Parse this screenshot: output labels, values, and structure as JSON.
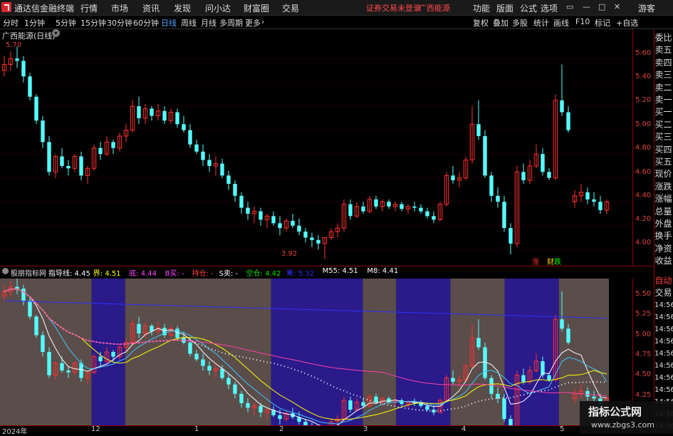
{
  "app": {
    "title": "通达信金融终端",
    "warning": "证券交易未登录",
    "stock_link": "广西能源",
    "guest": "游客"
  },
  "menu": [
    "行情",
    "市场",
    "资讯",
    "发现",
    "问小达",
    "财富圈",
    "交易"
  ],
  "right_menu": [
    "功能",
    "版面",
    "公式",
    "选项"
  ],
  "toolbar": {
    "periods": [
      "分时",
      "1分钟",
      "5分钟",
      "15分钟",
      "30分钟",
      "60分钟",
      "日线",
      "周线",
      "月线",
      "多周期",
      "更多"
    ],
    "active": "日线",
    "right": [
      "复权",
      "叠加",
      "多股",
      "统计",
      "画线",
      "F10",
      "标记",
      "+自选"
    ]
  },
  "chart_title": "广西能源(日线)",
  "price_axis": [
    "5.60",
    "5.40",
    "5.20",
    "5.00",
    "4.80",
    "4.60",
    "4.40",
    "4.20",
    "4.00"
  ],
  "high_label": "5.70",
  "low_label": "3.92",
  "badges": {
    "zhang": "涨",
    "cai": "财",
    "die": "跌"
  },
  "right_panel": [
    "委比",
    "卖五",
    "卖四",
    "卖三",
    "卖二",
    "卖一",
    "买一",
    "买二",
    "买三",
    "买四",
    "买五",
    "现价",
    "涨跌",
    "涨幅",
    "总量",
    "外盘",
    "换手",
    "净资",
    "收益"
  ],
  "right_panel2": [
    "自动",
    "交易"
  ],
  "times": [
    "14:56",
    "14:56",
    "14:56",
    "14:56",
    "14:56",
    "14:56",
    "14:56",
    "14:56",
    "14:56",
    "14:56",
    "14:56"
  ],
  "indicator": {
    "name": "股朋指标网",
    "items": [
      {
        "label": "指导线: 4.45",
        "color": "#ffffff"
      },
      {
        "label": "界: 4.51",
        "color": "#ffff00"
      },
      {
        "label": "底: 4.44",
        "color": "#ff4bff"
      },
      {
        "label": "B买: -",
        "color": "#ff4bff"
      },
      {
        "label": "持仓: -",
        "color": "#ff4040"
      },
      {
        "label": "S卖: -",
        "color": "#ffffff"
      },
      {
        "label": "空仓: 4.42",
        "color": "#00e000"
      },
      {
        "label": "筹: 5.32",
        "color": "#3030ff"
      },
      {
        "label": "M55: 4.51",
        "color": "#ffffff"
      },
      {
        "label": "M8: 4.41",
        "color": "#ffffff"
      }
    ]
  },
  "ind_axis": [
    "5.50",
    "5.25",
    "5.00",
    "4.75",
    "4.50",
    "4.25"
  ],
  "xaxis": [
    "2024年",
    "12",
    "1",
    "2",
    "3",
    "4",
    "5"
  ],
  "watermark": {
    "line1": "指标公式网",
    "line2": "www.zbgs3.com"
  },
  "colors": {
    "up": "#ff3030",
    "down": "#54ffff",
    "accent": "#4ea3ff"
  },
  "chart_data": {
    "type": "candlestick",
    "ylim": [
      3.9,
      5.75
    ],
    "ohlc": [
      [
        5.5,
        5.62,
        5.45,
        5.55
      ],
      [
        5.55,
        5.66,
        5.5,
        5.6
      ],
      [
        5.6,
        5.7,
        5.52,
        5.58
      ],
      [
        5.58,
        5.62,
        5.4,
        5.45
      ],
      [
        5.45,
        5.48,
        5.25,
        5.28
      ],
      [
        5.28,
        5.3,
        5.05,
        5.08
      ],
      [
        5.08,
        5.12,
        4.85,
        4.9
      ],
      [
        4.9,
        4.95,
        4.62,
        4.65
      ],
      [
        4.65,
        4.8,
        4.6,
        4.78
      ],
      [
        4.78,
        4.85,
        4.68,
        4.7
      ],
      [
        4.7,
        4.75,
        4.62,
        4.68
      ],
      [
        4.68,
        4.8,
        4.65,
        4.78
      ],
      [
        4.78,
        4.82,
        4.58,
        4.62
      ],
      [
        4.62,
        4.7,
        4.55,
        4.68
      ],
      [
        4.68,
        4.88,
        4.66,
        4.85
      ],
      [
        4.85,
        4.9,
        4.75,
        4.8
      ],
      [
        4.8,
        4.95,
        4.78,
        4.9
      ],
      [
        4.9,
        4.92,
        4.8,
        4.85
      ],
      [
        4.85,
        4.98,
        4.82,
        4.95
      ],
      [
        4.95,
        5.05,
        4.9,
        5.0
      ],
      [
        5.0,
        5.25,
        4.98,
        5.2
      ],
      [
        5.2,
        5.28,
        5.05,
        5.1
      ],
      [
        5.1,
        5.22,
        5.05,
        5.18
      ],
      [
        5.18,
        5.2,
        5.08,
        5.12
      ],
      [
        5.12,
        5.22,
        5.08,
        5.16
      ],
      [
        5.16,
        5.2,
        5.05,
        5.08
      ],
      [
        5.08,
        5.18,
        5.05,
        5.15
      ],
      [
        5.15,
        5.18,
        5.02,
        5.05
      ],
      [
        5.05,
        5.12,
        4.98,
        5.0
      ],
      [
        5.0,
        5.05,
        4.85,
        4.88
      ],
      [
        4.88,
        4.92,
        4.8,
        4.82
      ],
      [
        4.82,
        4.88,
        4.7,
        4.75
      ],
      [
        4.75,
        4.8,
        4.65,
        4.7
      ],
      [
        4.7,
        4.78,
        4.62,
        4.72
      ],
      [
        4.72,
        4.76,
        4.6,
        4.62
      ],
      [
        4.62,
        4.66,
        4.5,
        4.55
      ],
      [
        4.55,
        4.58,
        4.4,
        4.45
      ],
      [
        4.45,
        4.48,
        4.3,
        4.35
      ],
      [
        4.35,
        4.4,
        4.25,
        4.3
      ],
      [
        4.3,
        4.36,
        4.22,
        4.32
      ],
      [
        4.32,
        4.35,
        4.2,
        4.25
      ],
      [
        4.25,
        4.3,
        4.18,
        4.28
      ],
      [
        4.28,
        4.32,
        4.2,
        4.22
      ],
      [
        4.22,
        4.28,
        4.12,
        4.18
      ],
      [
        4.18,
        4.26,
        4.15,
        4.24
      ],
      [
        4.24,
        4.3,
        4.18,
        4.2
      ],
      [
        4.2,
        4.26,
        4.12,
        4.15
      ],
      [
        4.15,
        4.18,
        4.06,
        4.1
      ],
      [
        4.1,
        4.14,
        4.02,
        4.08
      ],
      [
        4.08,
        4.12,
        4.0,
        4.05
      ],
      [
        4.05,
        4.1,
        3.92,
        4.1
      ],
      [
        4.1,
        4.18,
        4.08,
        4.15
      ],
      [
        4.15,
        4.22,
        4.1,
        4.18
      ],
      [
        4.18,
        4.42,
        4.15,
        4.38
      ],
      [
        4.38,
        4.42,
        4.25,
        4.28
      ],
      [
        4.28,
        4.4,
        4.26,
        4.36
      ],
      [
        4.36,
        4.4,
        4.3,
        4.32
      ],
      [
        4.32,
        4.45,
        4.3,
        4.42
      ],
      [
        4.42,
        4.45,
        4.34,
        4.36
      ],
      [
        4.36,
        4.42,
        4.32,
        4.4
      ],
      [
        4.4,
        4.42,
        4.34,
        4.36
      ],
      [
        4.36,
        4.4,
        4.32,
        4.38
      ],
      [
        4.38,
        4.4,
        4.32,
        4.34
      ],
      [
        4.34,
        4.38,
        4.3,
        4.36
      ],
      [
        4.36,
        4.4,
        4.32,
        4.35
      ],
      [
        4.35,
        4.38,
        4.3,
        4.32
      ],
      [
        4.32,
        4.35,
        4.26,
        4.28
      ],
      [
        4.28,
        4.32,
        4.22,
        4.25
      ],
      [
        4.25,
        4.4,
        4.24,
        4.38
      ],
      [
        4.38,
        4.65,
        4.36,
        4.62
      ],
      [
        4.62,
        4.7,
        4.55,
        4.58
      ],
      [
        4.58,
        4.65,
        4.52,
        4.6
      ],
      [
        4.6,
        4.78,
        4.58,
        4.75
      ],
      [
        4.75,
        5.2,
        4.72,
        5.05
      ],
      [
        5.05,
        5.25,
        4.92,
        4.95
      ],
      [
        4.95,
        5.0,
        4.6,
        4.62
      ],
      [
        4.62,
        4.65,
        4.4,
        4.45
      ],
      [
        4.45,
        4.52,
        4.35,
        4.4
      ],
      [
        4.4,
        4.45,
        4.15,
        4.18
      ],
      [
        4.18,
        4.22,
        3.96,
        4.05
      ],
      [
        4.05,
        4.7,
        4.02,
        4.65
      ],
      [
        4.65,
        4.72,
        4.55,
        4.58
      ],
      [
        4.58,
        4.75,
        4.55,
        4.7
      ],
      [
        4.7,
        4.88,
        4.68,
        4.8
      ],
      [
        4.8,
        4.85,
        4.62,
        4.65
      ],
      [
        4.65,
        4.68,
        4.58,
        4.6
      ],
      [
        4.6,
        5.3,
        4.58,
        5.25
      ],
      [
        5.25,
        5.55,
        5.12,
        5.15
      ],
      [
        5.15,
        5.2,
        4.98,
        5.0
      ],
      [
        4.4,
        4.5,
        4.35,
        4.45
      ],
      [
        4.45,
        4.55,
        4.4,
        4.48
      ],
      [
        4.48,
        4.52,
        4.38,
        4.42
      ],
      [
        4.42,
        4.48,
        4.36,
        4.4
      ],
      [
        4.4,
        4.45,
        4.3,
        4.33
      ],
      [
        4.33,
        4.42,
        4.3,
        4.4
      ]
    ]
  }
}
